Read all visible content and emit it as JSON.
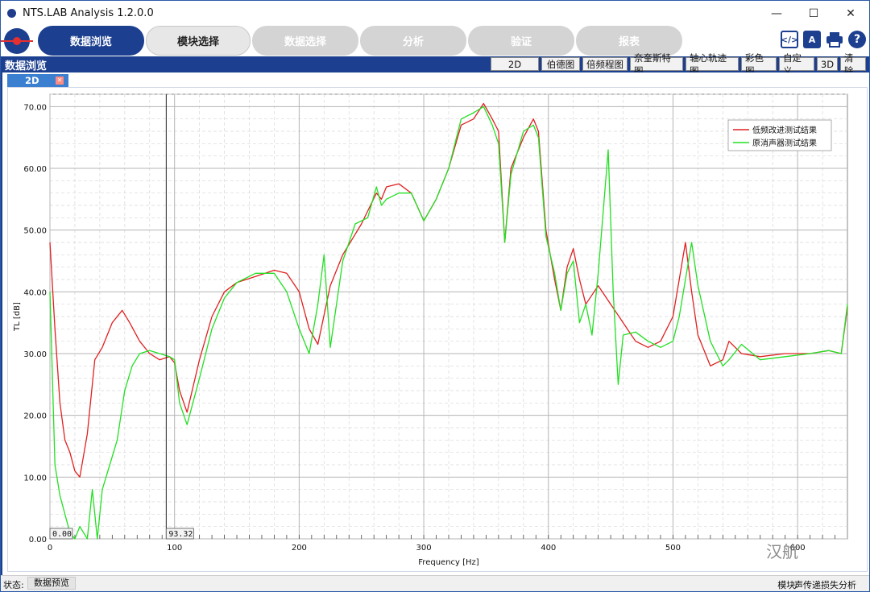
{
  "window": {
    "title": "NTS.LAB Analysis 1.2.0.0"
  },
  "nav": {
    "tabs": [
      {
        "label": "数据浏览",
        "state": "active"
      },
      {
        "label": "模块选择",
        "state": "normal"
      },
      {
        "label": "数据选择",
        "state": "disabled"
      },
      {
        "label": "分析",
        "state": "disabled"
      },
      {
        "label": "验证",
        "state": "disabled"
      },
      {
        "label": "报表",
        "state": "disabled"
      }
    ],
    "tools": [
      {
        "icon": "code-icon",
        "color": "#1c3f8f"
      },
      {
        "icon": "translate-icon",
        "color": "#1c3f8f"
      },
      {
        "icon": "print-icon",
        "color": "#1c3f8f"
      },
      {
        "icon": "help-icon",
        "color": "#1c3f8f"
      }
    ]
  },
  "section": {
    "title": "数据浏览",
    "view_buttons": [
      "2D",
      "伯德图",
      "倍频程图",
      "奈奎斯特图",
      "轴心轨迹图",
      "彩色图",
      "自定义",
      "3D",
      "清除"
    ]
  },
  "doc_tab": {
    "label": "2D"
  },
  "status": {
    "label": "状态:",
    "value": "数据预览",
    "module_label": "模块:",
    "module_value": "声传递损失分析"
  },
  "watermark": "汉航",
  "chart_data": {
    "type": "line",
    "xlabel": "Frequency [Hz]",
    "ylabel": "TL [dB]",
    "xlim": [
      0,
      640
    ],
    "ylim": [
      0,
      72
    ],
    "xticks": [
      0,
      100,
      200,
      300,
      400,
      500,
      600
    ],
    "xtick_labels": [
      "0",
      "100",
      "200",
      "300",
      "400",
      "500",
      "600"
    ],
    "yticks": [
      0,
      10,
      20,
      30,
      40,
      50,
      60,
      70
    ],
    "ytick_labels": [
      "0.00",
      "10.00",
      "20.00",
      "30.00",
      "40.00",
      "50.00",
      "60.00",
      "70.00"
    ],
    "grid": true,
    "legend_position": "top-right",
    "cursor": {
      "x": 93.32,
      "x_label": "93.32",
      "y_label": "0.00"
    },
    "series": [
      {
        "name": "低频改进测试结果",
        "color": "#e02020",
        "x": [
          0,
          4,
          8,
          12,
          16,
          20,
          24,
          30,
          36,
          42,
          50,
          58,
          64,
          72,
          80,
          88,
          96,
          100,
          104,
          110,
          120,
          130,
          140,
          150,
          165,
          180,
          190,
          200,
          208,
          215,
          225,
          235,
          250,
          262,
          266,
          270,
          280,
          290,
          300,
          310,
          320,
          330,
          340,
          348,
          355,
          360,
          365,
          370,
          380,
          388,
          392,
          398,
          405,
          410,
          415,
          420,
          425,
          430,
          440,
          450,
          460,
          470,
          480,
          490,
          500,
          505,
          510,
          515,
          520,
          530,
          540,
          545,
          555,
          570,
          590,
          610,
          625,
          635,
          640
        ],
        "y": [
          48,
          34,
          22,
          16,
          14,
          11,
          10,
          17,
          29,
          31,
          35,
          37,
          35,
          32,
          30,
          29,
          29.5,
          28.5,
          24,
          20.5,
          29,
          36,
          40,
          41.5,
          42.5,
          43.5,
          43,
          40,
          34,
          31.5,
          41,
          46,
          51,
          56,
          55,
          57,
          57.5,
          56,
          51.5,
          55,
          60,
          67,
          68,
          70.5,
          68,
          66,
          48,
          60,
          65,
          68,
          66,
          50,
          42,
          37,
          44,
          47,
          42,
          38,
          41,
          38,
          35,
          32,
          31,
          32,
          36,
          42,
          48,
          40,
          33,
          28,
          29,
          32,
          30,
          29.5,
          30,
          30,
          30.5,
          30,
          37.5
        ]
      },
      {
        "name": "原消声器测试结果",
        "color": "#22e022",
        "x": [
          0,
          4,
          8,
          12,
          16,
          20,
          24,
          30,
          34,
          38,
          42,
          48,
          54,
          60,
          66,
          72,
          80,
          88,
          96,
          100,
          104,
          110,
          120,
          130,
          140,
          150,
          165,
          180,
          190,
          200,
          208,
          215,
          220,
          225,
          235,
          245,
          255,
          262,
          266,
          270,
          280,
          290,
          300,
          310,
          320,
          330,
          340,
          348,
          355,
          360,
          365,
          370,
          380,
          388,
          392,
          398,
          405,
          410,
          415,
          420,
          425,
          430,
          435,
          440,
          448,
          452,
          456,
          460,
          470,
          480,
          490,
          500,
          505,
          510,
          515,
          520,
          530,
          540,
          545,
          555,
          570,
          590,
          610,
          625,
          635,
          640
        ],
        "y": [
          40,
          12,
          7,
          4,
          1,
          0,
          2,
          0,
          8,
          0,
          8,
          12,
          16,
          24,
          28,
          30,
          30.5,
          30,
          29.5,
          29,
          22,
          18.5,
          26,
          34,
          39,
          41.5,
          43,
          43,
          40,
          34,
          30,
          38,
          46,
          31,
          45,
          51,
          52,
          57,
          54,
          55,
          56,
          56,
          51.5,
          55,
          60,
          68,
          69,
          70,
          67,
          64,
          48,
          59,
          66,
          67,
          65,
          49,
          43,
          37,
          43,
          45,
          35,
          38,
          33,
          43,
          63,
          40,
          25,
          33,
          33.5,
          32,
          31,
          32,
          36,
          42,
          48,
          41,
          32,
          28,
          29,
          31.5,
          29,
          29.5,
          30,
          30.5,
          30,
          38
        ]
      }
    ]
  }
}
